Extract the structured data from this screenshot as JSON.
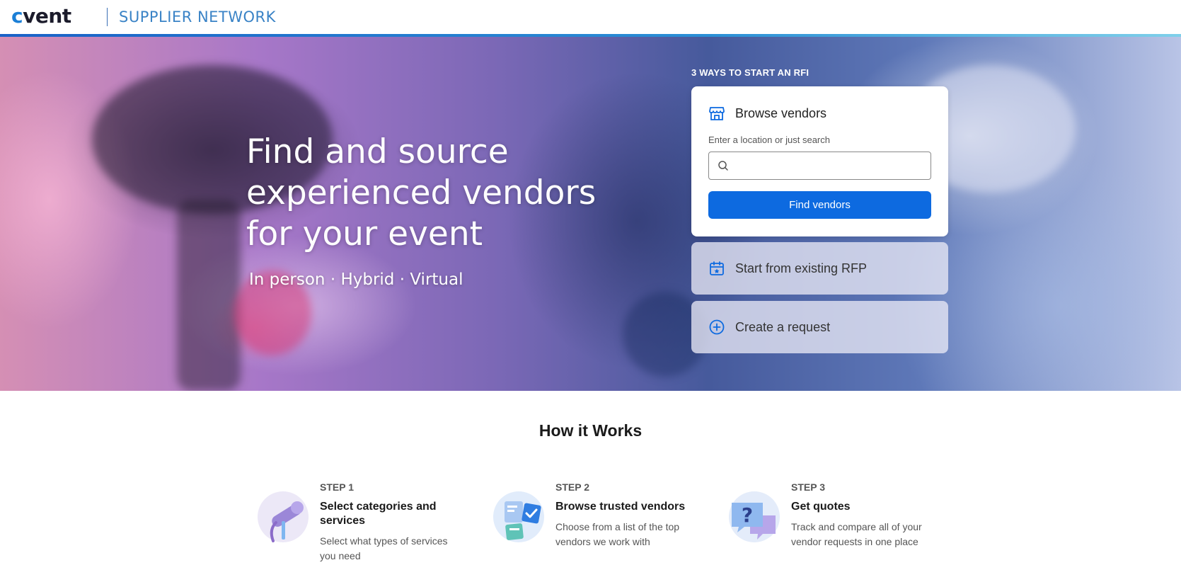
{
  "header": {
    "logo_text": "cvent",
    "brand_subtitle": "SUPPLIER NETWORK"
  },
  "hero": {
    "title": "Find and source experienced vendors for your event",
    "subtitle": "In person · Hybrid · Virtual"
  },
  "rfi": {
    "label": "3 WAYS TO START AN RFI",
    "browse": {
      "title": "Browse vendors",
      "field_label": "Enter a location or just search",
      "placeholder": "",
      "button_label": "Find vendors"
    },
    "existing_rfp": {
      "title": "Start from existing RFP"
    },
    "create_request": {
      "title": "Create a request"
    }
  },
  "how_it_works": {
    "title": "How it Works",
    "steps": [
      {
        "step_label": "STEP 1",
        "heading": "Select categories and services",
        "description": "Select what types of services you need",
        "icon": "microphone-icon"
      },
      {
        "step_label": "STEP 2",
        "heading": "Browse trusted vendors",
        "description": "Choose from a list of the top vendors we work with",
        "icon": "checklist-icon"
      },
      {
        "step_label": "STEP 3",
        "heading": "Get quotes",
        "description": "Track and compare all of your vendor requests in one place",
        "icon": "question-chat-icon"
      }
    ]
  },
  "colors": {
    "brand_blue": "#0d6ae0",
    "logo_accent": "#1b7fd6",
    "subtitle_blue": "#3a83c6"
  }
}
